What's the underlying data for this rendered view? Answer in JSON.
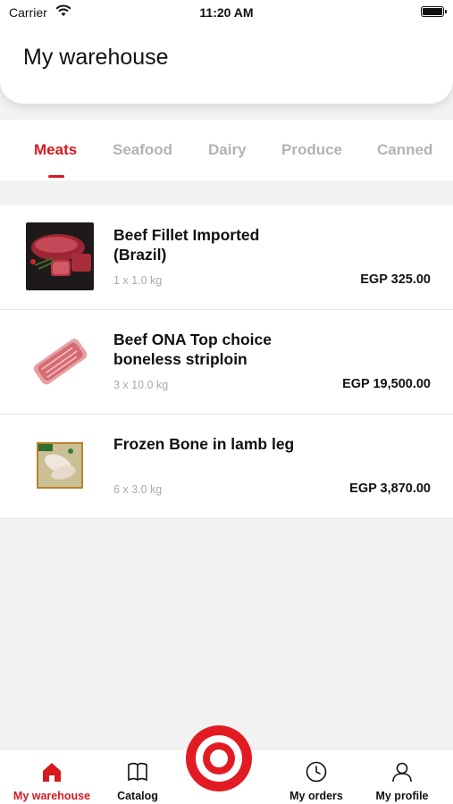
{
  "status_bar": {
    "carrier": "Carrier",
    "time": "11:20 AM"
  },
  "header": {
    "title": "My warehouse"
  },
  "tabs": [
    {
      "label": "Meats",
      "active": true
    },
    {
      "label": "Seafood",
      "active": false
    },
    {
      "label": "Dairy",
      "active": false
    },
    {
      "label": "Produce",
      "active": false
    },
    {
      "label": "Canned",
      "active": false
    }
  ],
  "products": [
    {
      "name": "Beef Fillet Imported (Brazil)",
      "qty": "1 x 1.0 kg",
      "price": "EGP 325.00",
      "image": "beef-fillet-image"
    },
    {
      "name": "Beef ONA Top choice boneless striploin",
      "qty": "3 x 10.0 kg",
      "price": "EGP 19,500.00",
      "image": "striploin-image"
    },
    {
      "name": "Frozen Bone in lamb leg",
      "qty": "6 x 3.0 kg",
      "price": "EGP 3,870.00",
      "image": "lamb-leg-image"
    }
  ],
  "bottom_nav": [
    {
      "label": "My warehouse",
      "icon": "home-icon",
      "active": true
    },
    {
      "label": "Catalog",
      "icon": "book-icon",
      "active": false
    },
    {
      "label": "My orders",
      "icon": "clock-icon",
      "active": false
    },
    {
      "label": "My profile",
      "icon": "person-icon",
      "active": false
    }
  ],
  "colors": {
    "accent": "#d71920",
    "inactive_tab": "#b3b3b3"
  }
}
